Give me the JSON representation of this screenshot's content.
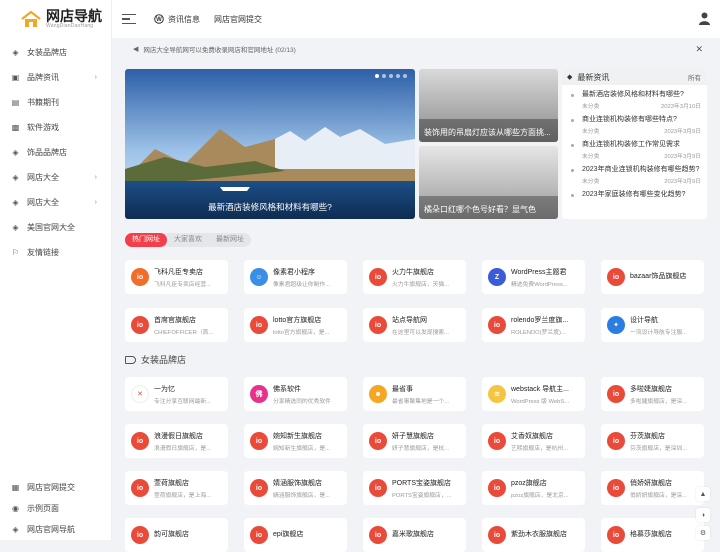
{
  "logo": {
    "title": "网店导航",
    "subtitle": "WangDianDaoHang"
  },
  "sidebar": {
    "items": [
      {
        "label": "女装品牌店",
        "icon": "cube-icon",
        "arrow": false
      },
      {
        "label": "品牌资讯",
        "icon": "image-icon",
        "arrow": true
      },
      {
        "label": "书籍期刊",
        "icon": "book-icon",
        "arrow": false
      },
      {
        "label": "软件游戏",
        "icon": "package-icon",
        "arrow": false
      },
      {
        "label": "饰品品牌店",
        "icon": "cube-icon",
        "arrow": false
      },
      {
        "label": "网店大全",
        "icon": "cube-icon",
        "arrow": true
      },
      {
        "label": "网店大全",
        "icon": "cube-icon",
        "arrow": true
      },
      {
        "label": "美国官网大全",
        "icon": "cube-icon",
        "arrow": false
      },
      {
        "label": "友情链接",
        "icon": "link-icon",
        "arrow": false
      }
    ],
    "bottom": [
      {
        "label": "网店官网提交",
        "icon": "calendar-icon"
      },
      {
        "label": "示例页面",
        "icon": "circle-icon"
      },
      {
        "label": "网店官网导航",
        "icon": "cube-icon"
      }
    ]
  },
  "topbar": {
    "links": [
      "资讯信息",
      "网店官网提交"
    ]
  },
  "notice": {
    "text": "网店大全导航网可以免费收录网店和官网地址 (02/13)"
  },
  "hero": {
    "caption": "最新酒店装修风格和材料有哪些?",
    "dots": 5,
    "active_dot": 0
  },
  "side_cards": [
    {
      "caption": "装饰用的吊扇灯应该从哪些方面挑..."
    },
    {
      "caption": "橘朵口红哪个色号好看？显气色"
    }
  ],
  "news": {
    "title": "最新资讯",
    "all": "所有",
    "items": [
      {
        "title": "最新酒店装修风格和材料有哪些?",
        "cat": "未分类",
        "date": "2023年3月10日"
      },
      {
        "title": "商业连锁机构装修有哪些特点?",
        "cat": "未分类",
        "date": "2023年3月9日"
      },
      {
        "title": "商业连锁机构装修工作常见需求",
        "cat": "未分类",
        "date": "2023年3月9日"
      },
      {
        "title": "2023年商业连锁机构装修有哪些趋势?",
        "cat": "未分类",
        "date": "2023年3月9日"
      },
      {
        "title": "2023年家庭装修有哪些变化趋势?",
        "cat": "",
        "date": ""
      }
    ]
  },
  "tabs": [
    "热门网址",
    "大家喜欢",
    "最新网址"
  ],
  "hot_sites": [
    {
      "name": "飞科凡臣专卖店",
      "desc": "飞科凡臣专卖店经营...",
      "color": "#f26d2a",
      "glyph": "io"
    },
    {
      "name": "像素君小程序",
      "desc": "像素君超级让你制作...",
      "color": "#3a8ee6",
      "glyph": "☺"
    },
    {
      "name": "火力牛旗舰店",
      "desc": "火力牛旗舰店，天猫...",
      "color": "#ea4a3a",
      "glyph": "io"
    },
    {
      "name": "WordPress主题君",
      "desc": "精选免费WordPress...",
      "color": "#3b5bd8",
      "glyph": "Z"
    },
    {
      "name": "bazaar饰品旗舰店",
      "desc": "",
      "color": "#ea4a3a",
      "glyph": "io"
    },
    {
      "name": "首席官旗舰店",
      "desc": "CHIEFOFFICER（首...",
      "color": "#ea4a3a",
      "glyph": "io"
    },
    {
      "name": "lotto官方旗舰店",
      "desc": "lotto官方旗舰店，是...",
      "color": "#ea4a3a",
      "glyph": "io"
    },
    {
      "name": "站点导航网",
      "desc": "在这里可以发现搜索...",
      "color": "#ea4a3a",
      "glyph": "io"
    },
    {
      "name": "rolendo罗兰度旗...",
      "desc": "ROLENDO(罗兰度)...",
      "color": "#ea4a3a",
      "glyph": "io"
    },
    {
      "name": "设计导航",
      "desc": "一流设计导航专注服...",
      "color": "#2a7de1",
      "glyph": "✦"
    }
  ],
  "section": {
    "title": "女装品牌店"
  },
  "women_sites": [
    {
      "name": "一为忆",
      "desc": "专注分享互联网最新...",
      "color": "#ffffff",
      "glyph": "✕"
    },
    {
      "name": "佛系软件",
      "desc": "分享精选同的优秀软件",
      "color": "#e8318a",
      "glyph": "佛"
    },
    {
      "name": "最省事",
      "desc": "最省事聚集地是一个...",
      "color": "#f5a623",
      "glyph": "☻"
    },
    {
      "name": "webstack 导航主...",
      "desc": "WordPress 版 WebS...",
      "color": "#f5c542",
      "glyph": "≋"
    },
    {
      "name": "多啦婕旗舰店",
      "desc": "多啦婕旗舰店，是深...",
      "color": "#ea4a3a",
      "glyph": "io"
    },
    {
      "name": "浪漫假日旗舰店",
      "desc": "浪漫假日旗舰店，是...",
      "color": "#ea4a3a",
      "glyph": "io"
    },
    {
      "name": "婉知新生旗舰店",
      "desc": "婉知新生旗舰店，是...",
      "color": "#ea4a3a",
      "glyph": "io"
    },
    {
      "name": "妍子慧旗舰店",
      "desc": "妍子慧旗舰店，是杭...",
      "color": "#ea4a3a",
      "glyph": "io"
    },
    {
      "name": "艾香奴旗舰店",
      "desc": "艺熙旗舰店，是杭州...",
      "color": "#ea4a3a",
      "glyph": "io"
    },
    {
      "name": "芬茨旗舰店",
      "desc": "芬茨旗舰店，是深圳...",
      "color": "#ea4a3a",
      "glyph": "io"
    },
    {
      "name": "萱荷旗舰店",
      "desc": "萱荷旗舰店，是上海...",
      "color": "#ea4a3a",
      "glyph": "io"
    },
    {
      "name": "婧涵服饰旗舰店",
      "desc": "婧涵服饰旗舰店，是...",
      "color": "#ea4a3a",
      "glyph": "io"
    },
    {
      "name": "PORTS宝姿旗舰店",
      "desc": "PORTS宝姿旗舰店，...",
      "color": "#ea4a3a",
      "glyph": "io"
    },
    {
      "name": "pzoz旗舰店",
      "desc": "pzoz旗舰店，是北京...",
      "color": "#ea4a3a",
      "glyph": "io"
    },
    {
      "name": "俏娇妍旗舰店",
      "desc": "俏娇妍旗舰店，是深...",
      "color": "#ea4a3a",
      "glyph": "io"
    },
    {
      "name": "韵可旗舰店",
      "desc": "",
      "color": "#ea4a3a",
      "glyph": "io"
    },
    {
      "name": "epi旗舰店",
      "desc": "",
      "color": "#ea4a3a",
      "glyph": "io"
    },
    {
      "name": "嘉米歌旗舰店",
      "desc": "",
      "color": "#ea4a3a",
      "glyph": "io"
    },
    {
      "name": "紫劲木衣服旗舰店",
      "desc": "",
      "color": "#ea4a3a",
      "glyph": "io"
    },
    {
      "name": "格慕莎旗舰店",
      "desc": "",
      "color": "#ea4a3a",
      "glyph": "io"
    }
  ],
  "colors": {
    "accent": "#f1404b",
    "bg": "#f1f3f6"
  }
}
